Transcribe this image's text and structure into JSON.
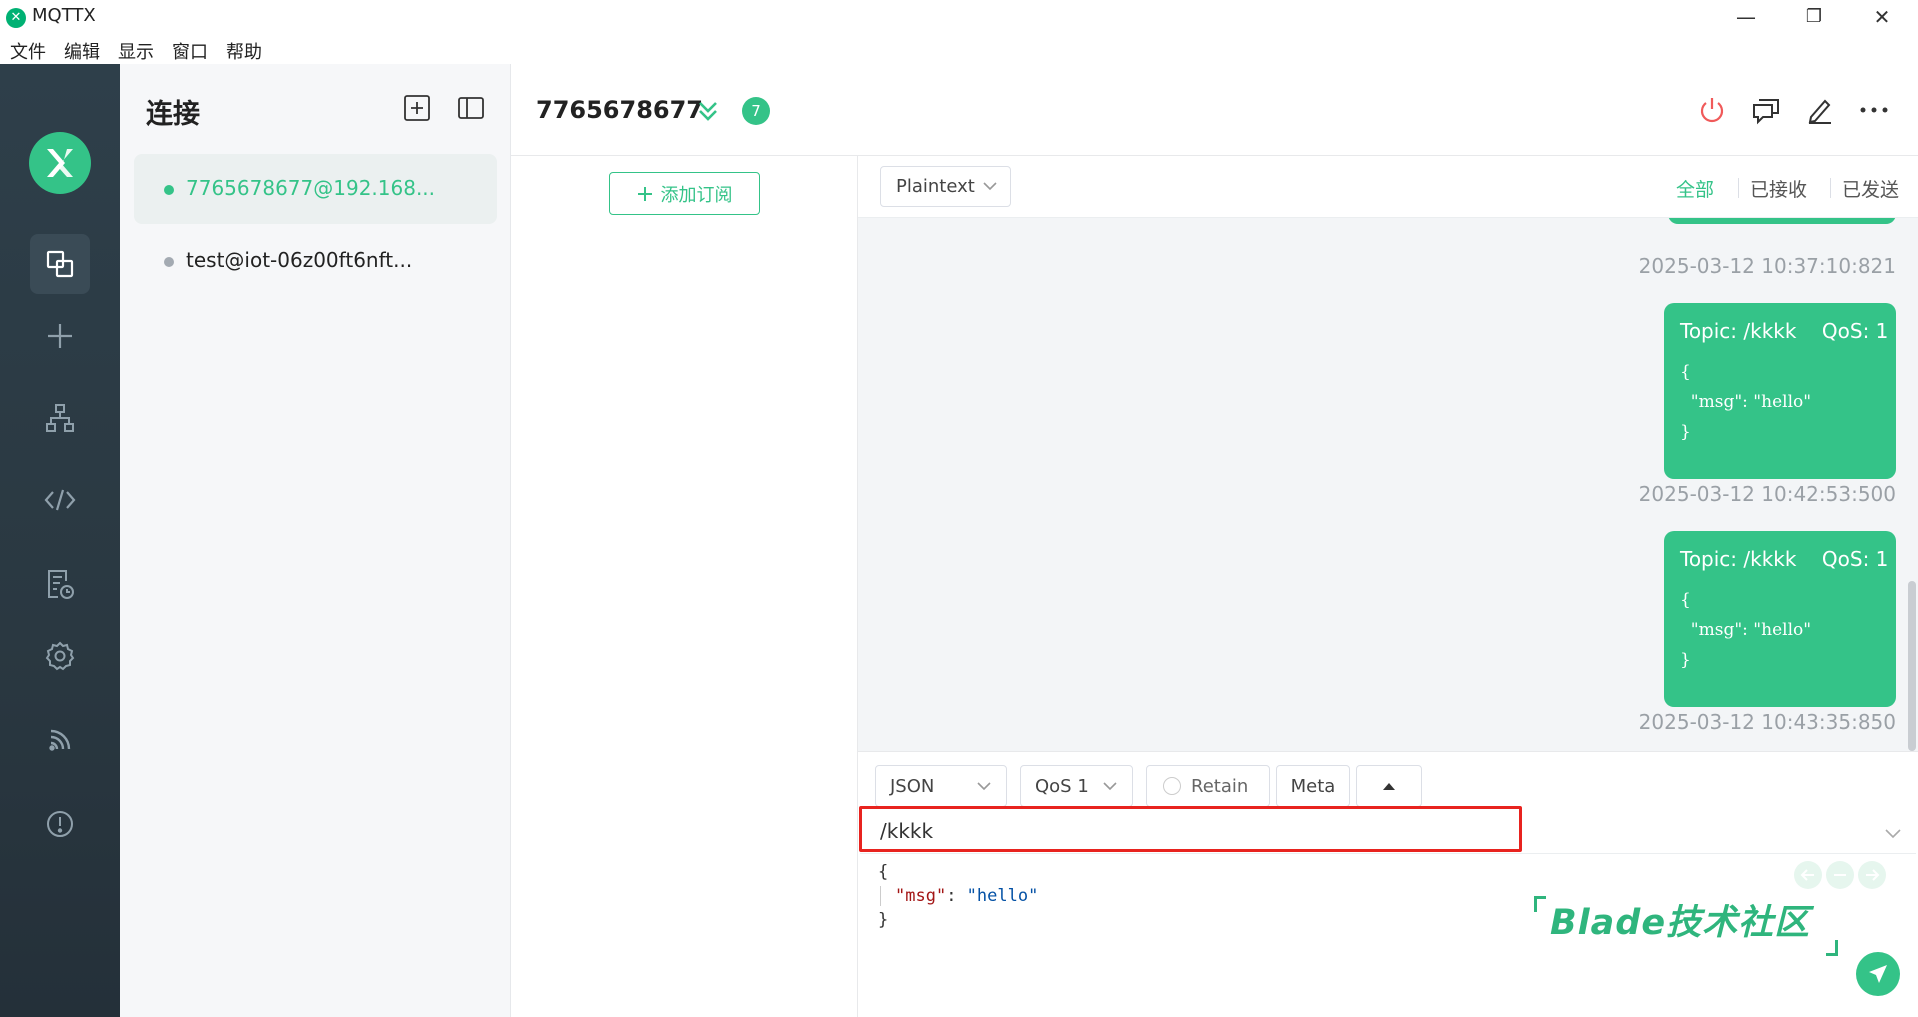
{
  "window": {
    "title": "MQTTX",
    "logo_letter": "✕",
    "controls": {
      "minimize": "—",
      "maximize": "❐",
      "close": "✕"
    }
  },
  "menu": [
    "文件",
    "编辑",
    "显示",
    "窗口",
    "帮助"
  ],
  "sidebar": {
    "icons": [
      "connections-icon",
      "add-icon",
      "topology-icon",
      "script-icon",
      "log-icon",
      "settings-icon",
      "feed-icon",
      "about-icon"
    ],
    "active": "connections-icon"
  },
  "connections": {
    "title": "连接",
    "items": [
      {
        "label": "7765678677@192.168...",
        "status": "connected",
        "active": true
      },
      {
        "label": "test@iot-06z00ft6nft...",
        "status": "disconnected",
        "active": false
      }
    ]
  },
  "header": {
    "connection_name": "7765678677",
    "unread_count": "7"
  },
  "subscriptions": {
    "add_label": "添加订阅"
  },
  "messages": {
    "format": "Plaintext",
    "filters": [
      "全部",
      "已接收",
      "已发送"
    ],
    "active_filter": "全部",
    "items": [
      {
        "topic": "Topic: /kkkk",
        "qos": "QoS: 1",
        "payload_lines": [
          "{",
          "  \"msg\": \"hello\"",
          "}"
        ],
        "time": "2025-03-12 10:42:53:500"
      },
      {
        "topic": "Topic: /kkkk",
        "qos": "QoS: 1",
        "payload_lines": [
          "{",
          "  \"msg\": \"hello\"",
          "}"
        ],
        "time": "2025-03-12 10:43:35:850"
      }
    ],
    "previous_time": "2025-03-12 10:37:10:821"
  },
  "composer": {
    "payload_format": "JSON",
    "qos": "QoS 1",
    "retain_label": "Retain",
    "meta_label": "Meta",
    "topic_value": "/kkkk",
    "payload_open": "{",
    "payload_key": "\"msg\"",
    "payload_colon": ": ",
    "payload_value": "\"hello\"",
    "payload_close": "}"
  },
  "watermark": "Blade技术社区",
  "colors": {
    "accent": "#34c388",
    "sidebar": "#2e3f4a",
    "danger": "#e8231f"
  }
}
